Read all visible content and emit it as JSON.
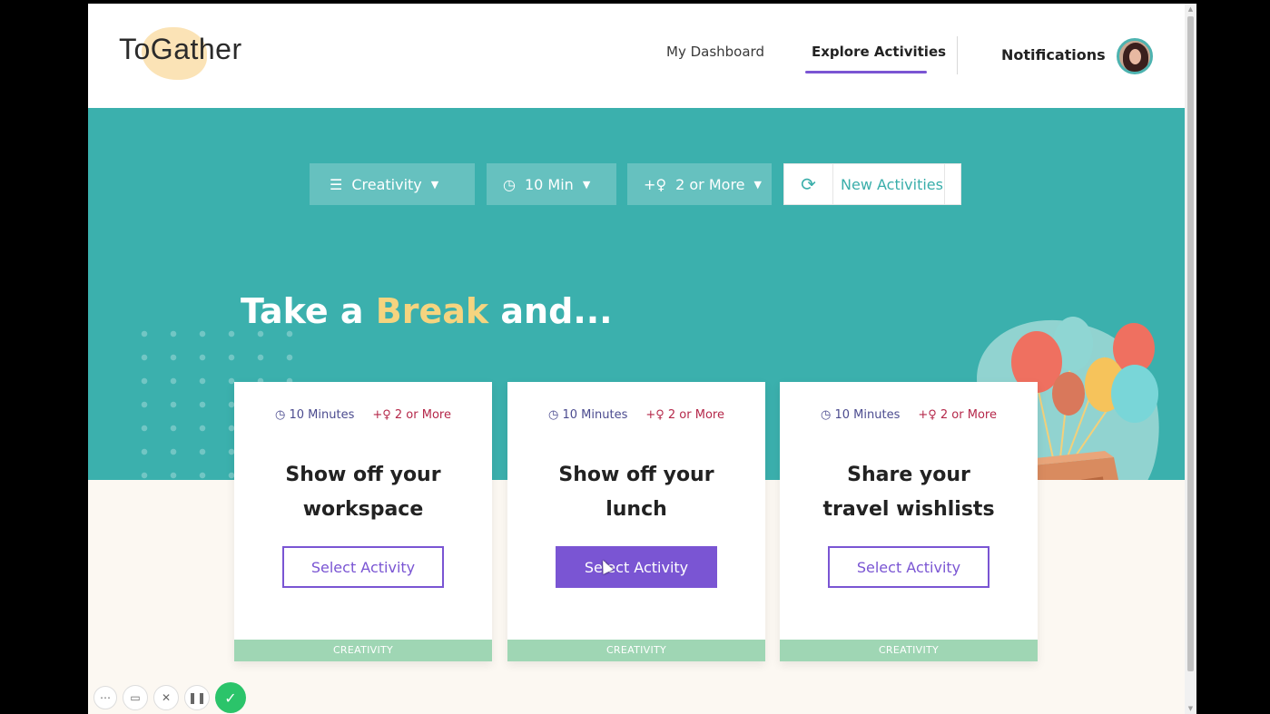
{
  "header": {
    "logo": "ToGather",
    "nav": {
      "dashboard": "My Dashboard",
      "explore": "Explore Activities",
      "notifications": "Notifications"
    }
  },
  "filters": {
    "category": "Creativity",
    "duration": "10 Min",
    "people": "2 or More",
    "new_activities": "New Activities"
  },
  "hero": {
    "prefix": "Take a ",
    "highlight": "Break",
    "suffix": " and..."
  },
  "cards": [
    {
      "time": "10 Minutes",
      "people": "2 or More",
      "title_line1": "Show off your",
      "title_line2": "workspace",
      "button": "Select Activity",
      "tag": "CREATIVITY"
    },
    {
      "time": "10 Minutes",
      "people": "2 or More",
      "title_line1": "Show off your",
      "title_line2": "lunch",
      "button": "Select Activity",
      "tag": "CREATIVITY"
    },
    {
      "time": "10 Minutes",
      "people": "2 or More",
      "title_line1": "Share your",
      "title_line2": "travel wishlists",
      "button": "Select Activity",
      "tag": "CREATIVITY"
    }
  ],
  "icons": {
    "filter": "filter-lines-icon",
    "clock": "clock-icon",
    "add_person": "add-person-icon",
    "refresh": "refresh-icon",
    "caret": "caret-down-icon"
  },
  "colors": {
    "teal": "#3bb0ad",
    "purple": "#7a55d3",
    "accent_yellow": "#f5d47f",
    "tag_green": "#9fd6b4",
    "people_red": "#b5284a"
  }
}
